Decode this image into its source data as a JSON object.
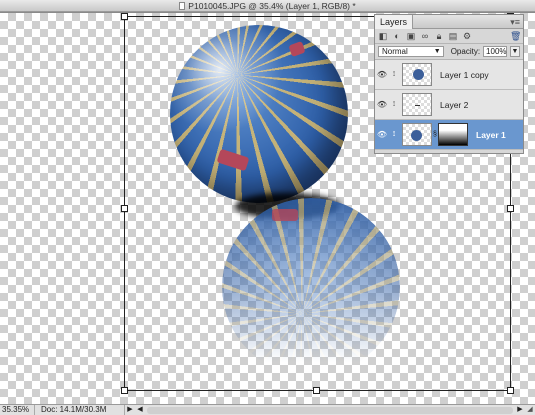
{
  "window": {
    "title": "P1010045.JPG @ 35.4% (Layer 1, RGB/8) *"
  },
  "layers_panel": {
    "tab_label": "Layers",
    "menu_icon": "panel-menu-icon",
    "blend_mode": "Normal",
    "opacity_label": "Opacity:",
    "opacity_value": "100%",
    "layers": [
      {
        "name": "Layer 1 copy",
        "selected": false,
        "visible": true
      },
      {
        "name": "Layer 2",
        "selected": false,
        "visible": true
      },
      {
        "name": "Layer 1",
        "selected": true,
        "visible": true
      }
    ],
    "selected_color": "#6a97cf"
  },
  "status": {
    "zoom": "35.35%",
    "doc_info": "Doc: 14.1M/30.3M"
  }
}
